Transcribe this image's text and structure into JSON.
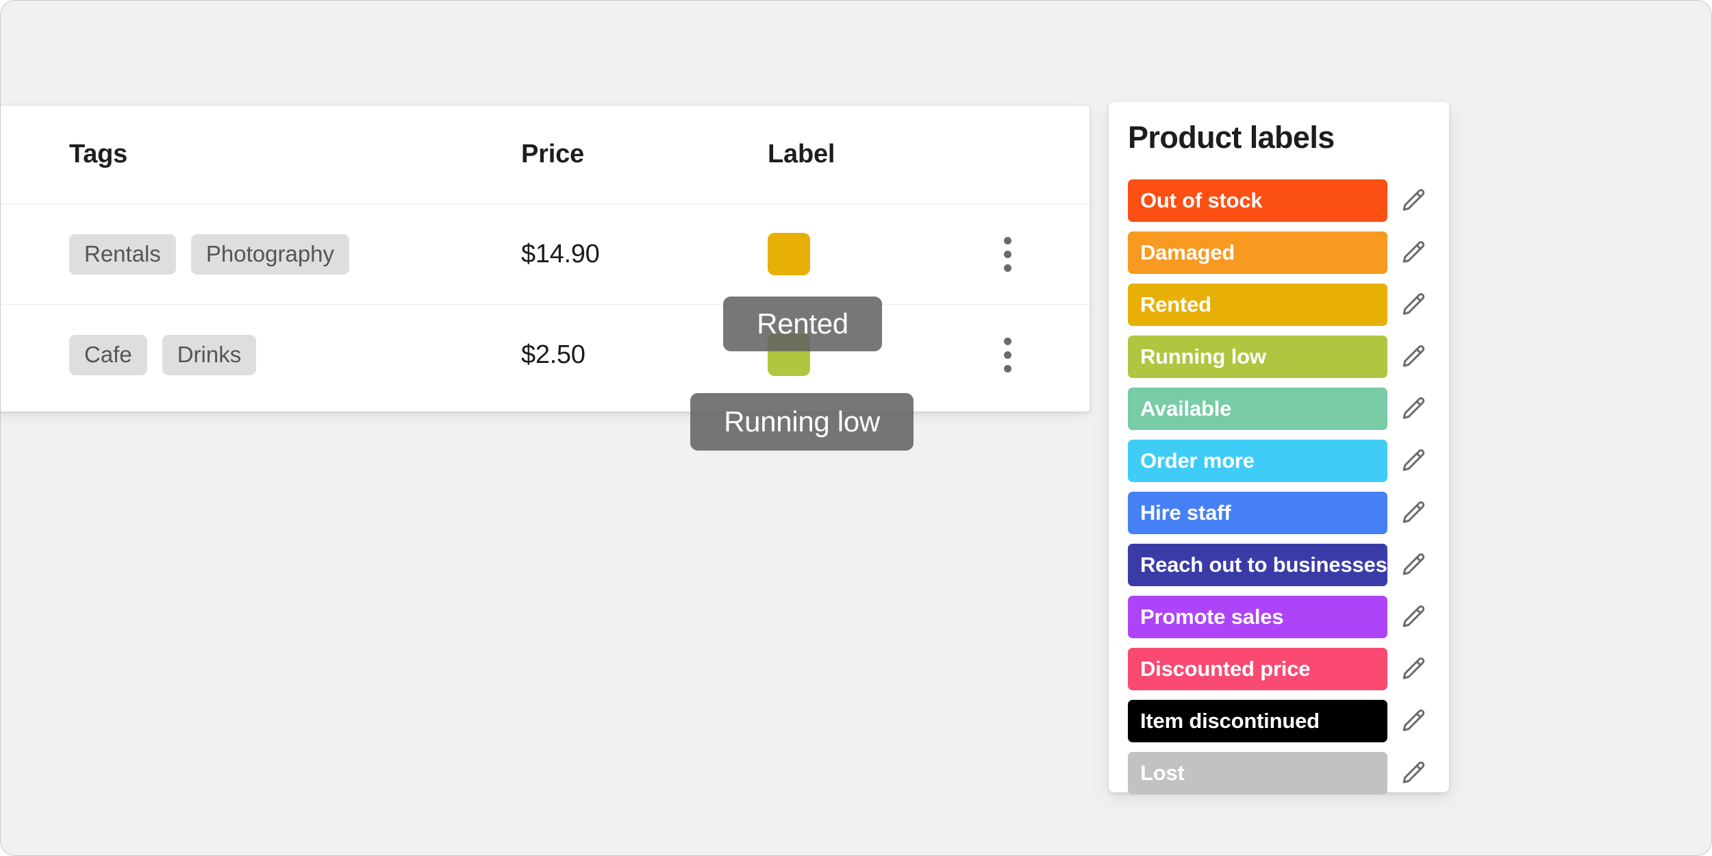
{
  "table": {
    "columns": [
      "Tags",
      "Price",
      "Label"
    ],
    "rows": [
      {
        "tags": [
          "Rentals",
          "Photography"
        ],
        "price": "$14.90",
        "label_name": "Rented",
        "label_color": "#E8B007",
        "menu_icon": "kebab-menu-icon"
      },
      {
        "tags": [
          "Cafe",
          "Drinks"
        ],
        "price": "$2.50",
        "label_name": "Running low",
        "label_color": "#AFC640",
        "menu_icon": "kebab-menu-icon"
      }
    ]
  },
  "tooltips": [
    {
      "text": "Rented",
      "background": "#616161"
    },
    {
      "text": "Running low",
      "background": "#616161"
    }
  ],
  "labels_panel": {
    "title": "Product labels",
    "edit_icon": "pencil-icon",
    "items": [
      {
        "name": "Out of stock",
        "color": "#FB4F14",
        "text_color": "#ffffff"
      },
      {
        "name": "Damaged",
        "color": "#F89A21",
        "text_color": "#ffffff"
      },
      {
        "name": "Rented",
        "color": "#E8B007",
        "text_color": "#ffffff"
      },
      {
        "name": "Running low",
        "color": "#AFC640",
        "text_color": "#ffffff"
      },
      {
        "name": "Available",
        "color": "#78CCA6",
        "text_color": "#ffffff"
      },
      {
        "name": "Order more",
        "color": "#3FCDF7",
        "text_color": "#ffffff"
      },
      {
        "name": "Hire staff",
        "color": "#4580F5",
        "text_color": "#ffffff"
      },
      {
        "name": "Reach out to businesses",
        "color": "#3B3BA8",
        "text_color": "#ffffff"
      },
      {
        "name": "Promote sales",
        "color": "#AE44F7",
        "text_color": "#ffffff"
      },
      {
        "name": "Discounted price",
        "color": "#FA4A72",
        "text_color": "#ffffff"
      },
      {
        "name": "Item discontinued",
        "color": "#000000",
        "text_color": "#ffffff"
      },
      {
        "name": "Lost",
        "color": "#C2C2C2",
        "text_color": "#ffffff"
      }
    ]
  },
  "theme": {
    "page_background": "#f1f1f1",
    "card_background": "#ffffff",
    "tag_background": "#dedede",
    "tag_text": "#555555",
    "divider": "#ececec"
  }
}
